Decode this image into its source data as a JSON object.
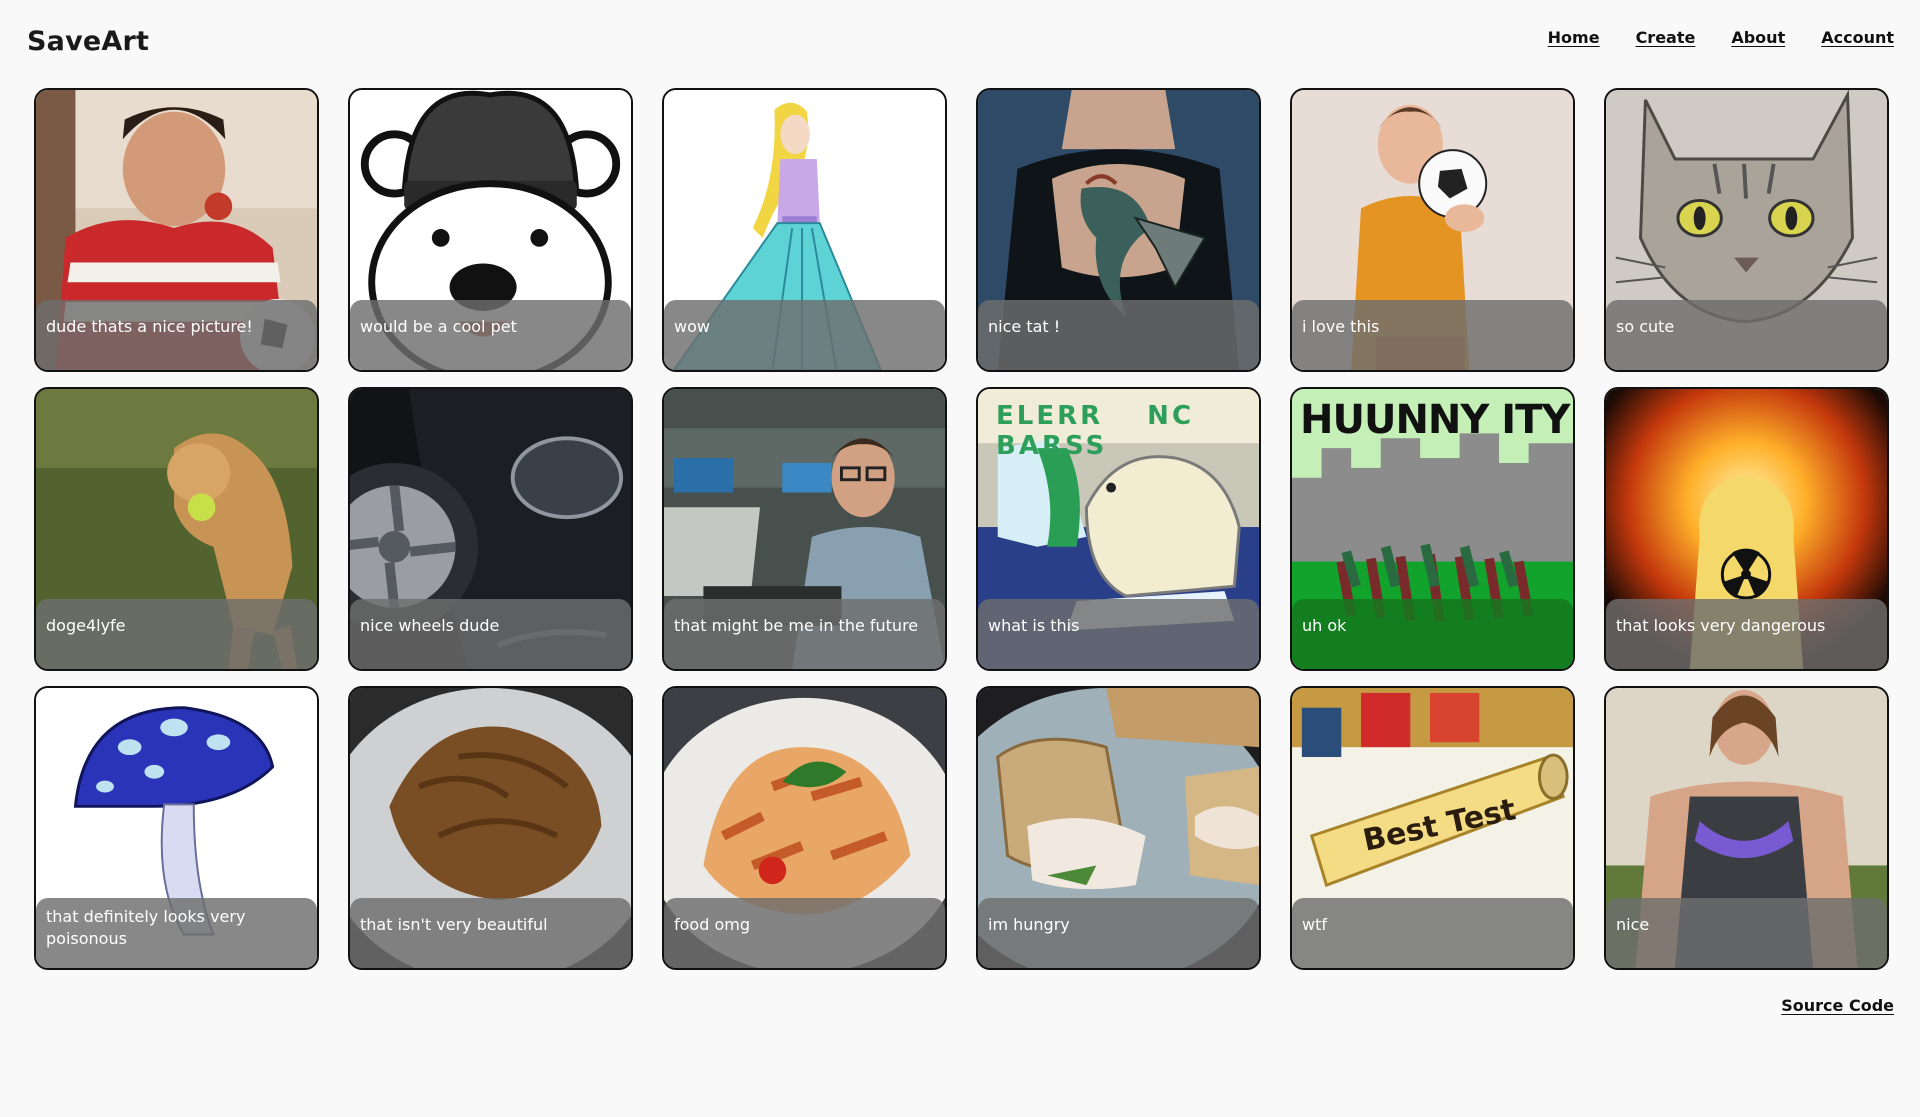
{
  "app": {
    "title": "SaveArt"
  },
  "nav": [
    {
      "label": "Home"
    },
    {
      "label": "Create"
    },
    {
      "label": "About"
    },
    {
      "label": "Account"
    }
  ],
  "gallery": [
    {
      "caption": "dude thats a nice picture!",
      "art": "boy-eating-apple-soccer"
    },
    {
      "caption": "would be a cool pet",
      "art": "cartoon-bear-in-beanie"
    },
    {
      "caption": "wow",
      "art": "princess-blue-gown"
    },
    {
      "caption": "nice tat !",
      "art": "dragon-back-tattoo"
    },
    {
      "caption": "i love this",
      "art": "boy-holding-soccer-ball"
    },
    {
      "caption": "so cute",
      "art": "pencil-cat-drawing"
    },
    {
      "caption": "doge4lyfe",
      "art": "golden-retriever-with-ball"
    },
    {
      "caption": "nice wheels dude",
      "art": "black-car-wheel"
    },
    {
      "caption": "that might be me in the future",
      "art": "man-at-computer"
    },
    {
      "caption": "what is this",
      "art": "polar-bear-poster",
      "picture_text": "ELERR NC BARSS"
    },
    {
      "caption": "uh ok",
      "art": "city-crowd-poster",
      "picture_text": "HUUNNY ITY"
    },
    {
      "caption": "that looks very dangerous",
      "art": "nuclear-explosion"
    },
    {
      "caption": "that definitely looks very poisonous",
      "art": "blue-mushroom"
    },
    {
      "caption": "that isn't very beautiful",
      "art": "brown-noodles-plate"
    },
    {
      "caption": "food omg",
      "art": "pasta-plate"
    },
    {
      "caption": "im hungry",
      "art": "chicken-sandwich"
    },
    {
      "caption": "wtf",
      "art": "best-test-blocks",
      "picture_text": "Best Test"
    },
    {
      "caption": "nice",
      "art": "woman-tank-top"
    }
  ],
  "footer": {
    "source_label": "Source Code"
  }
}
